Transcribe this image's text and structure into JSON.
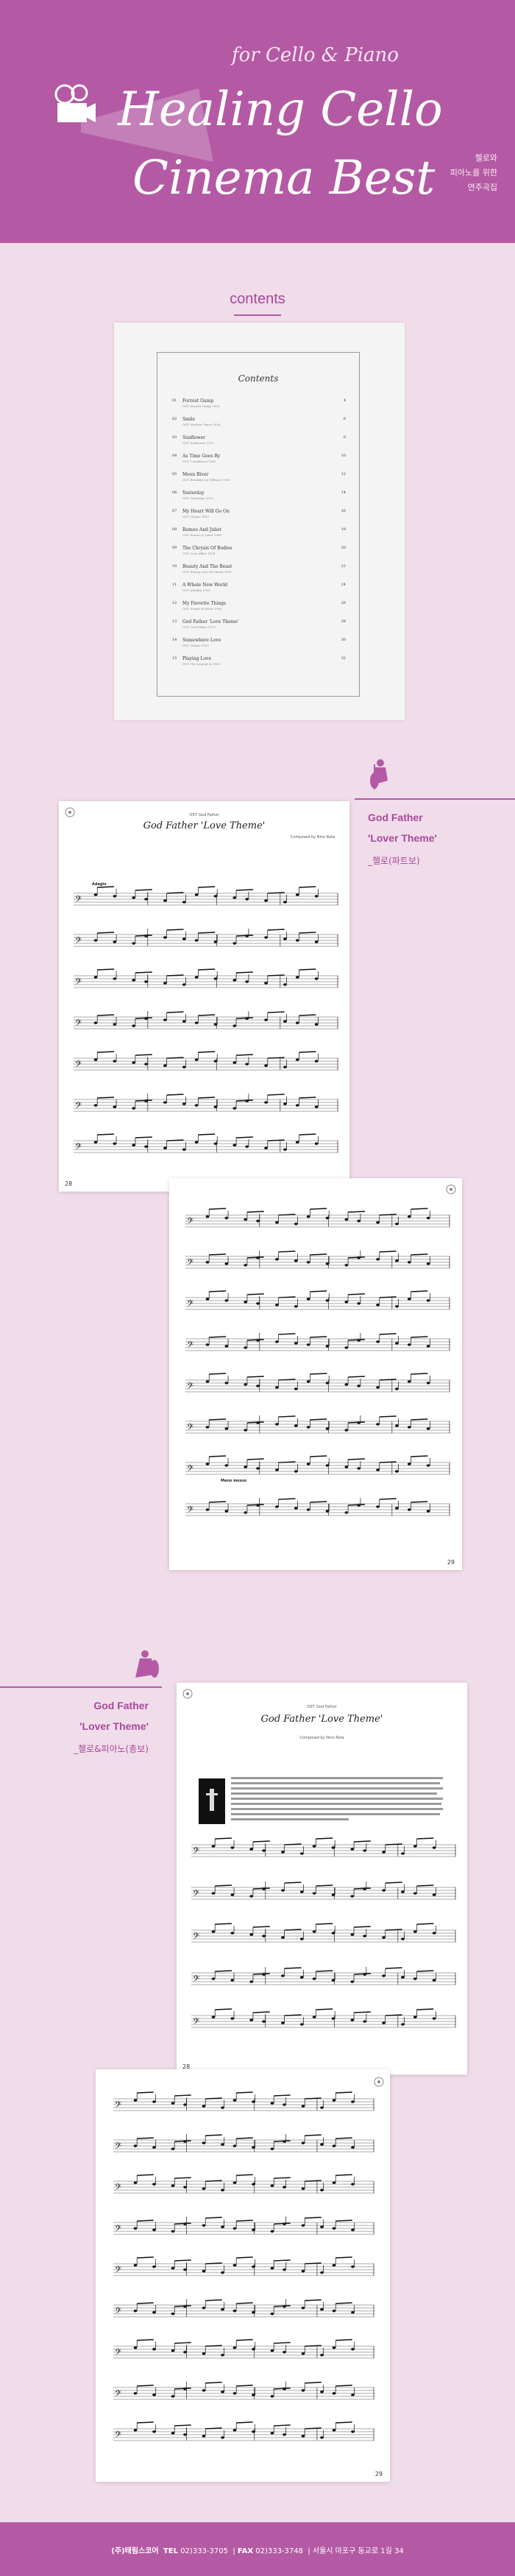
{
  "header": {
    "subtitle": "for Cello & Piano",
    "title_line1": "Healing Cello",
    "title_line2": "Cinema Best",
    "tagline": [
      "첼로와",
      "피아노를 위한",
      "연주곡집"
    ],
    "bg_color": "#b45aa4"
  },
  "contents_label": "contents",
  "contents_page": {
    "title": "Contents",
    "items": [
      {
        "n": "01",
        "song": "Forrest Gump",
        "credit": "OST. Forrest Gump 2002",
        "page": "4"
      },
      {
        "n": "02",
        "song": "Smile",
        "credit": "OST. Modern Times 1936",
        "page": "6"
      },
      {
        "n": "03",
        "song": "Sunflower",
        "credit": "OST. Sunflower 1970",
        "page": "8"
      },
      {
        "n": "04",
        "song": "As Time Goes By",
        "credit": "OST. Casablanca 1942",
        "page": "10"
      },
      {
        "n": "05",
        "song": "Moon River",
        "credit": "OST. Breakfast at Tiffany's 1961",
        "page": "12"
      },
      {
        "n": "06",
        "song": "Yesterday",
        "credit": "OST. Yesterday 2019",
        "page": "14"
      },
      {
        "n": "07",
        "song": "My Heart Will Go On",
        "credit": "OST. Titanic 1997",
        "page": "16"
      },
      {
        "n": "08",
        "song": "Romeo And Juliet",
        "credit": "OST. Romeo & Juliet 1968",
        "page": "18"
      },
      {
        "n": "09",
        "song": "The Chrysis Of Bodies",
        "credit": "OST. Love Affair 1994",
        "page": "20"
      },
      {
        "n": "10",
        "song": "Beauty And The Beast",
        "credit": "OST. Beauty And The Beast 1991",
        "page": "22"
      },
      {
        "n": "11",
        "song": "A Whole New World",
        "credit": "OST. Aladdin 1992",
        "page": "24"
      },
      {
        "n": "12",
        "song": "My Favorite Things",
        "credit": "OST. Sound of Music 1965",
        "page": "26"
      },
      {
        "n": "13",
        "song": "God Father 'Love Theme'",
        "credit": "OST. God Father 1972",
        "page": "28"
      },
      {
        "n": "14",
        "song": "Somewhere Love",
        "credit": "OST. Titanic 1997",
        "page": "30"
      },
      {
        "n": "15",
        "song": "Playing Love",
        "credit": "OST. The Legend of 1900",
        "page": "32"
      }
    ]
  },
  "section1": {
    "title_line1": "God Father",
    "title_line2": "'Lover Theme'",
    "subtitle": "_첼로(파트보)"
  },
  "section2": {
    "title_line1": "God Father",
    "title_line2": "'Lover Theme'",
    "subtitle": "_첼로&피아노(총보)"
  },
  "score_pages": {
    "p1": {
      "title": "God Father 'Love Theme'",
      "ost": "OST. God Father",
      "composer": "Composed by Nino Rota",
      "tempo": "Adagio",
      "page_num": "28"
    },
    "p2": {
      "page_num": "29",
      "marking": "Meno mosso"
    },
    "p3": {
      "title": "God Father 'Love Theme'",
      "ost": "OST. God Father",
      "composer": "Composed by Nino Rota",
      "page_num": "28"
    },
    "p4": {
      "page_num": "29"
    }
  },
  "footer": {
    "company": "(주)태림스코어",
    "tel_label": "TEL",
    "tel": "02)333-3705",
    "fax_label": "FAX",
    "fax": "02)333-3748",
    "address": "서울시 마포구 동교로 1길 34"
  }
}
